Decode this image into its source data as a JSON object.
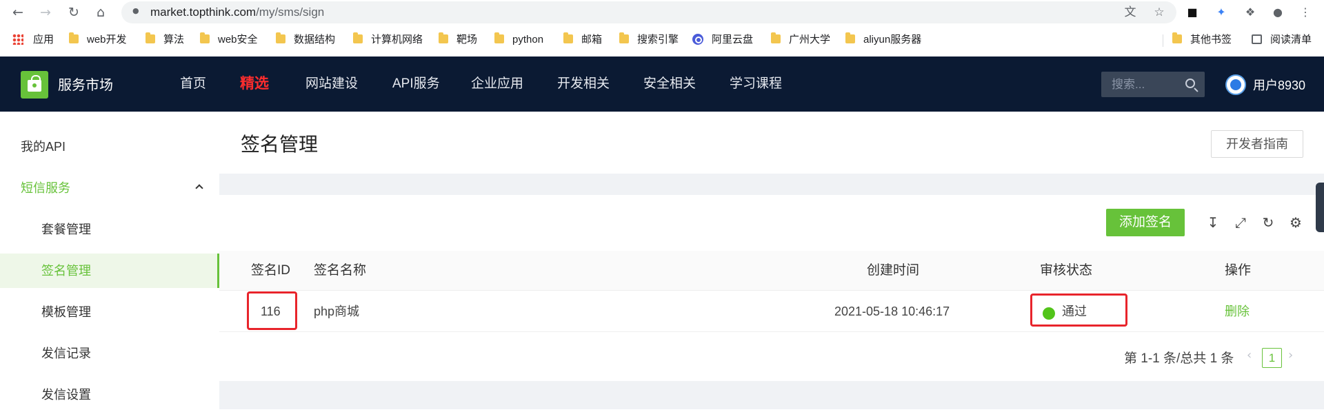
{
  "browser": {
    "url_host": "market.topthink.com",
    "url_path": "/my/sms/sign",
    "bookmarks": [
      {
        "label": "应用",
        "icon": "apps-icon"
      },
      {
        "label": "web开发",
        "icon": "folder-icon"
      },
      {
        "label": "算法",
        "icon": "folder-icon"
      },
      {
        "label": "web安全",
        "icon": "folder-icon"
      },
      {
        "label": "数据结构",
        "icon": "folder-icon"
      },
      {
        "label": "计算机网络",
        "icon": "folder-icon"
      },
      {
        "label": "靶场",
        "icon": "folder-icon"
      },
      {
        "label": "python",
        "icon": "folder-icon"
      },
      {
        "label": "邮箱",
        "icon": "folder-icon"
      },
      {
        "label": "搜索引擎",
        "icon": "folder-icon"
      },
      {
        "label": "阿里云盘",
        "icon": "cloud-icon"
      },
      {
        "label": "广州大学",
        "icon": "folder-icon"
      },
      {
        "label": "aliyun服务器",
        "icon": "folder-icon"
      }
    ],
    "other_bookmarks": "其他书签",
    "reading_list": "阅读清单"
  },
  "site": {
    "name": "服务市场",
    "nav": [
      "首页",
      "精选",
      "网站建设",
      "API服务",
      "企业应用",
      "开发相关",
      "安全相关",
      "学习课程"
    ],
    "search_placeholder": "搜索...",
    "user": "用户8930",
    "accent": "#67c23a",
    "header_bg": "#0b1a33",
    "highlight": "#ff2d2d"
  },
  "sidebar": {
    "my_api": "我的API",
    "sms_group": "短信服务",
    "items": [
      "套餐管理",
      "签名管理",
      "模板管理",
      "发信记录",
      "发信设置"
    ]
  },
  "page": {
    "title": "签名管理",
    "guide_button": "开发者指南",
    "add_button": "添加签名"
  },
  "table": {
    "columns": [
      "签名ID",
      "签名名称",
      "创建时间",
      "审核状态",
      "操作"
    ],
    "rows": [
      {
        "id": "116",
        "name": "php商城",
        "created": "2021-05-18 10:46:17",
        "status": "通过",
        "action": "删除"
      }
    ]
  },
  "pagination": {
    "summary": "第 1-1 条/总共 1 条",
    "current": "1"
  }
}
